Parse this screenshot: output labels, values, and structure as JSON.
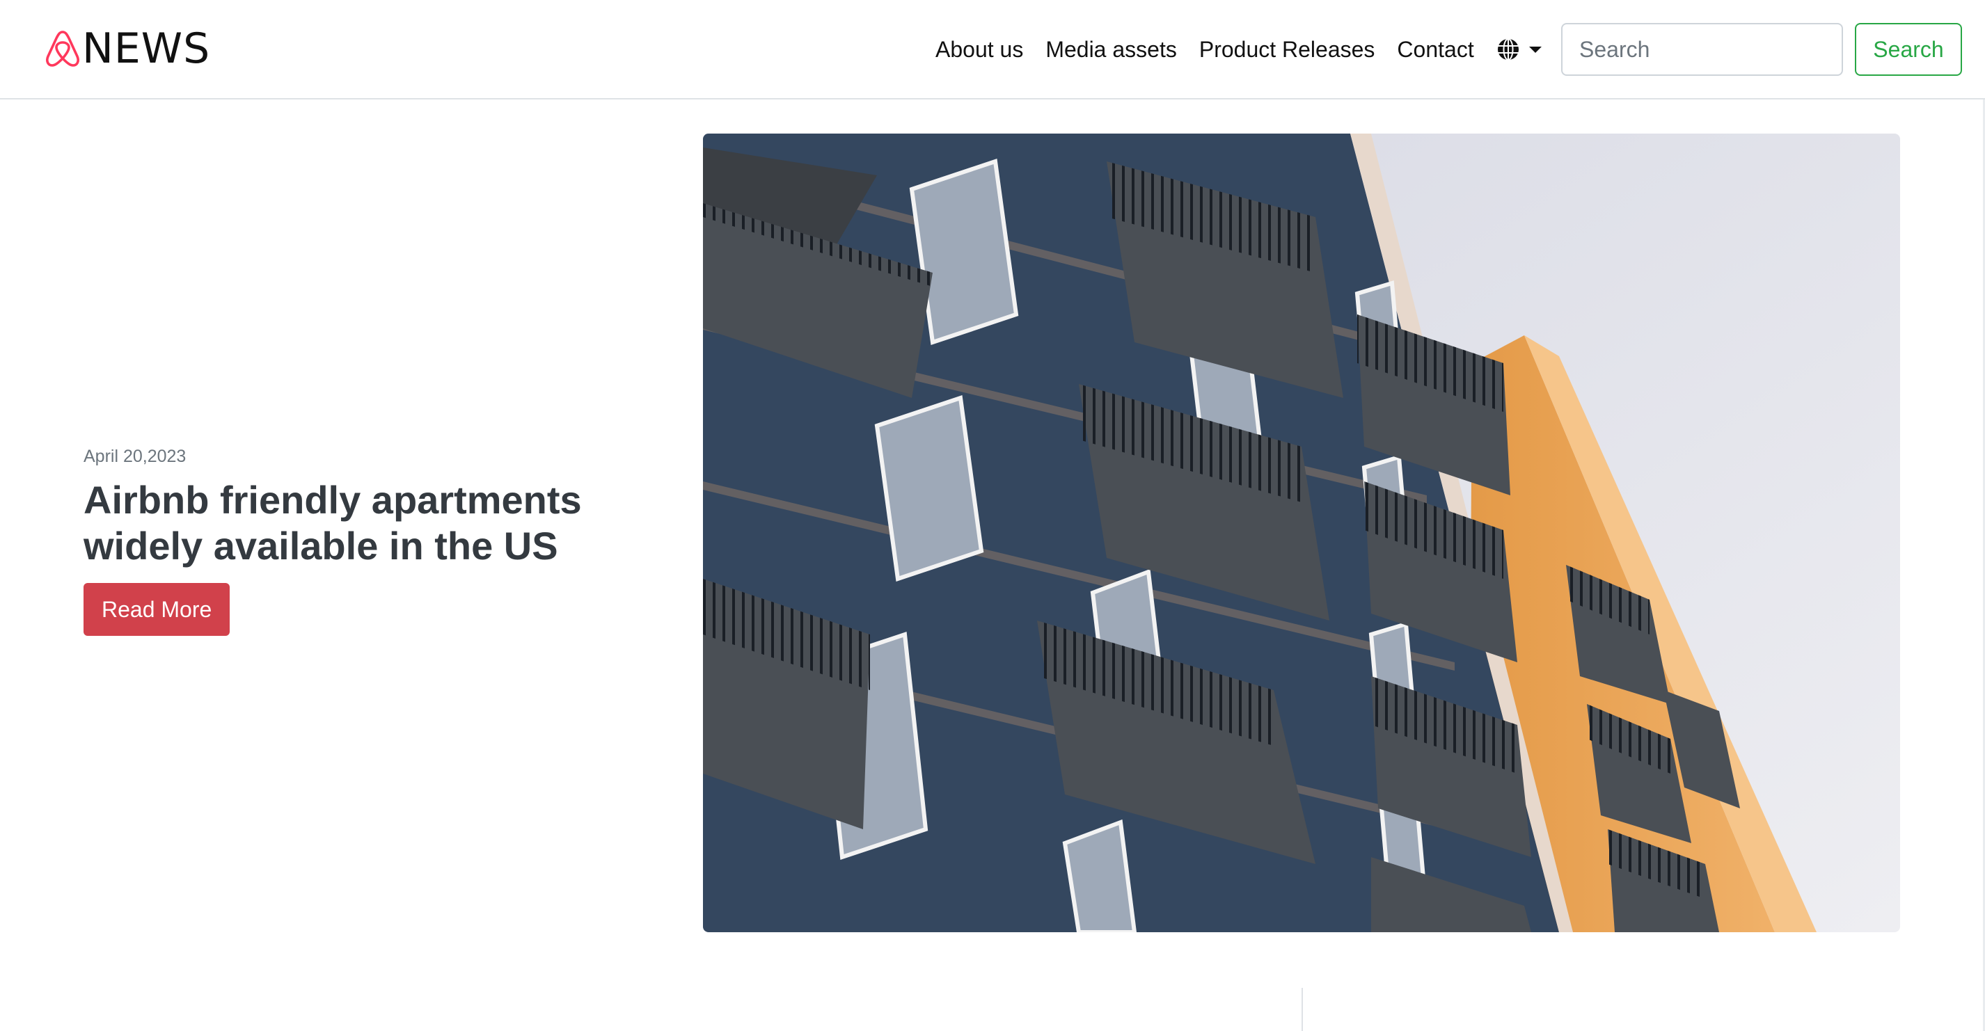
{
  "brand": {
    "logo_icon": "airbnb-belo-icon",
    "name": "NEWS",
    "logo_color": "#ff385c"
  },
  "nav": {
    "items": [
      {
        "label": "About us"
      },
      {
        "label": "Media assets"
      },
      {
        "label": "Product Releases"
      },
      {
        "label": "Contact"
      }
    ],
    "language_icon": "globe-icon",
    "language_caret_icon": "caret-down-icon"
  },
  "search": {
    "placeholder": "Search",
    "button_label": "Search",
    "button_color": "#28a745"
  },
  "hero": {
    "date": "April 20,2023",
    "title": "Airbnb friendly apartments widely available in the US",
    "read_more_label": "Read More",
    "read_more_color": "#d1414b",
    "image_description": "apartment-building-balconies-photo"
  }
}
